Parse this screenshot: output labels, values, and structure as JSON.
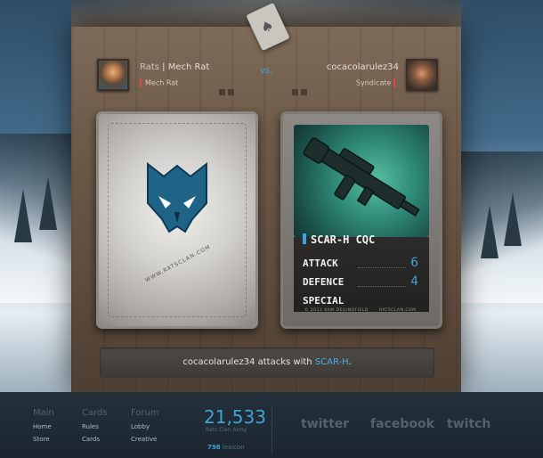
{
  "header": {
    "player1": {
      "clan": "Rats",
      "name": "Mech Rat",
      "subtitle": "Mech Rat"
    },
    "vs": "vs.",
    "player2": {
      "name": "cocacolarulez34",
      "subtitle": "Syndicate"
    }
  },
  "card_back": {
    "site": "WWW.RATSCLAN.COM"
  },
  "card": {
    "name": "SCAR-H CQC",
    "stats": [
      {
        "label": "ATTACK",
        "value": "6"
      },
      {
        "label": "DEFENCE",
        "value": "4"
      },
      {
        "label": "SPECIAL",
        "value": ""
      }
    ],
    "footer_left": "© 2012 KAM DEGINOFIELD",
    "footer_right": "RATSCLAN.COM"
  },
  "log": {
    "actor": "cocacolarulez34",
    "verb": " attacks with ",
    "weapon": "SCAR-H",
    "end": "."
  },
  "footer": {
    "nav": [
      {
        "heading": "Main",
        "links": [
          "Home",
          "Store"
        ]
      },
      {
        "heading": "Cards",
        "links": [
          "Rules",
          "Cards"
        ]
      },
      {
        "heading": "Forum",
        "links": [
          "Lobby",
          "Creative"
        ]
      }
    ],
    "counter": "21,533",
    "counter_label": "Rats Clan Army",
    "counter2_value": "798",
    "counter2_label": "lexicon",
    "social": [
      "twitter",
      "facebook",
      "twitch"
    ]
  },
  "colors": {
    "accent": "#3fa3d6",
    "health": "#e24545"
  },
  "icons": [
    "ace-of-spades-icon",
    "rat-emblem-icon",
    "rifle-icon"
  ]
}
